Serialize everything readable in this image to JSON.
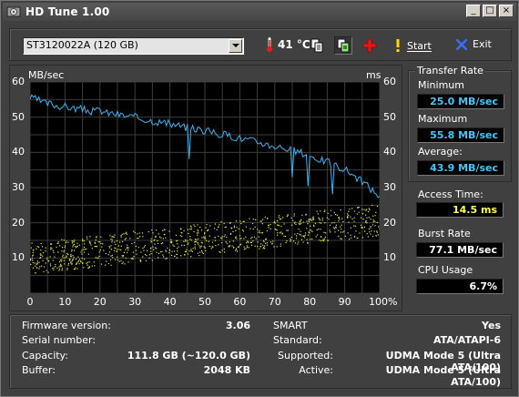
{
  "window": {
    "title": "HD Tune 1.00",
    "min_glyph": "_",
    "max_glyph": "□",
    "close_glyph": "×"
  },
  "toolbar": {
    "drive": "ST3120022A (120 GB)",
    "temperature": "41 °C",
    "start_label": "Start",
    "exit_label": "Exit"
  },
  "chart_data": {
    "type": "line",
    "x_label_unit": "",
    "y_left_unit": "MB/sec",
    "y_right_unit": "ms",
    "x_ticks": [
      "0",
      "10",
      "20",
      "30",
      "40",
      "50",
      "60",
      "70",
      "80",
      "90",
      "100%"
    ],
    "y_ticks": [
      "10",
      "20",
      "30",
      "40",
      "50",
      "60"
    ],
    "xlim": [
      0,
      100
    ],
    "ylim": [
      0,
      60
    ],
    "grid": true,
    "series": [
      {
        "kind": "line",
        "color": "#3cb4f0",
        "x": [
          0,
          2,
          4,
          6,
          8,
          10,
          12,
          14,
          16,
          18,
          20,
          22,
          24,
          26,
          28,
          30,
          32,
          34,
          36,
          38,
          40,
          42,
          44,
          46,
          48,
          50,
          52,
          54,
          56,
          58,
          60,
          62,
          64,
          66,
          68,
          70,
          72,
          74,
          76,
          78,
          80,
          82,
          84,
          86,
          88,
          90,
          92,
          94,
          96,
          98,
          100
        ],
        "y": [
          55.5,
          55,
          54,
          53.8,
          53.2,
          53,
          52.6,
          52.4,
          52,
          51.6,
          52,
          51.2,
          51,
          50.6,
          50.2,
          50,
          49.5,
          49.2,
          48.8,
          48.5,
          48,
          47.8,
          47.2,
          47,
          46.6,
          46.2,
          45.8,
          45.2,
          45,
          44.6,
          44,
          43.6,
          43.2,
          42.8,
          42.2,
          41.8,
          41.5,
          41,
          40.4,
          39.8,
          39,
          38.4,
          37.6,
          37,
          36,
          35.2,
          34,
          32.4,
          31,
          29.2,
          27.5
        ]
      },
      {
        "kind": "scatter",
        "color": "#e8e840",
        "trend": {
          "x": [
            0,
            100
          ],
          "y": [
            10,
            21
          ]
        }
      }
    ]
  },
  "transfer_rate": {
    "title": "Transfer Rate",
    "min_label": "Minimum",
    "min_value": "25.0 MB/sec",
    "max_label": "Maximum",
    "max_value": "55.8 MB/sec",
    "avg_label": "Average:",
    "avg_value": "43.9 MB/sec"
  },
  "access_time": {
    "label": "Access Time:",
    "value": "14.5 ms"
  },
  "burst_rate": {
    "label": "Burst Rate",
    "value": "77.1 MB/sec"
  },
  "cpu_usage": {
    "label": "CPU Usage",
    "value": "6.7%"
  },
  "info": {
    "firmware_label": "Firmware version:",
    "firmware_value": "3.06",
    "serial_label": "Serial number:",
    "serial_value": "",
    "capacity_label": "Capacity:",
    "capacity_value": "111.8 GB (~120.0 GB)",
    "buffer_label": "Buffer:",
    "buffer_value": "2048 KB",
    "smart_label": "SMART",
    "smart_value": "Yes",
    "standard_label": "Standard:",
    "standard_value": "ATA/ATAPI-6",
    "supported_label": "Supported:",
    "supported_value": "UDMA Mode 5 (Ultra ATA/100)",
    "active_label": "Active:",
    "active_value": "UDMA Mode 5 (Ultra ATA/100)"
  }
}
